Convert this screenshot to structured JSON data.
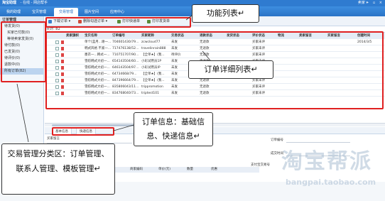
{
  "titlebar": {
    "brand": "淘宝助理",
    "subtitle": "- 在线 - 网店帮手",
    "user": "卖家 ▾",
    "controls": "– ▫ ×"
  },
  "nav": {
    "tabs": [
      "我的助理",
      "宝贝管理",
      "交易管理",
      "图片空间",
      "应用中心"
    ],
    "active_index": 2
  },
  "sidebar": {
    "header": "订单管理",
    "items": [
      {
        "label": "待发货(0)",
        "sub": false
      },
      {
        "label": "买家已付款(0)",
        "sub": true
      },
      {
        "label": "等待卖家发货(0)",
        "sub": true
      },
      {
        "label": "待付款(0)",
        "sub": false
      },
      {
        "label": "已发货(0)",
        "sub": false
      },
      {
        "label": "待评价(0)",
        "sub": false
      },
      {
        "label": "退款中(0)",
        "sub": false
      },
      {
        "label": "所有订单(82)",
        "sub": false,
        "active": true
      }
    ]
  },
  "toolbar": {
    "buttons": [
      {
        "label": "下载订单 ▾",
        "icon": "download-icon",
        "color": "#3a7ecb"
      },
      {
        "label": "删除勾选订单 ▾",
        "icon": "delete-icon",
        "color": "#d04a3a"
      },
      {
        "label": "打印快递单",
        "icon": "print-icon",
        "color": "#5a8a3a"
      },
      {
        "label": "打印发货单",
        "icon": "print-icon",
        "color": "#5a8a3a"
      }
    ]
  },
  "grid": {
    "total_label": "共计: 82",
    "headers": [
      "",
      "卖家旗帜",
      "宝贝名称",
      "订单编号",
      "买家昵称",
      "交易状态",
      "退款状态",
      "发货状态",
      "评价状态",
      "物流",
      "卖家留言",
      "买家留言",
      "创建时间"
    ],
    "rows": [
      {
        "name": "单个[蓝月...谢一...",
        "order": "704601430/79...",
        "buyer": "zcwcloud77",
        "status": "未发",
        "refund": "无退款",
        "rate": "买家未评",
        "time": "2014/3/5"
      },
      {
        "name": "韩式风格 不紧一...",
        "order": "717476138/52...",
        "buyer": "travelinrain888",
        "status": "未发",
        "refund": "无退款",
        "rate": "买家未评",
        "time": ""
      },
      {
        "name": "墨衣一...韩式一...",
        "order": "710751707/90...",
        "buyer": "【全单★】(我...",
        "status": "待评价",
        "refund": "无退款",
        "rate": "买家未评",
        "time": ""
      },
      {
        "name": "雪纺韩式大初一...",
        "order": "654143504/60...",
        "buyer": "小彩试用员1P",
        "status": "未发",
        "refund": "无退款",
        "rate": "买家未评",
        "time": ""
      },
      {
        "name": "雪纺韩式大初一...",
        "order": "646143504/97...",
        "buyer": "小彩试用员IP",
        "status": "未发",
        "refund": "无退款",
        "rate": "买家未评",
        "time": ""
      },
      {
        "name": "雪纺韩式大初一...",
        "order": "64734668/79...",
        "buyer": "【全单★】(我...",
        "status": "未发",
        "refund": "无退款",
        "rate": "买家未评",
        "time": ""
      },
      {
        "name": "雪纺韩式大初一...",
        "order": "847396664/79...",
        "buyer": "【全单★】(我...",
        "status": "未发",
        "refund": "无退款",
        "rate": "买家未评",
        "time": ""
      },
      {
        "name": "雪纺韩式大初一...",
        "order": "835806043/11...",
        "buyer": "trippromotion",
        "status": "未发",
        "refund": "无退款",
        "rate": "买家未评",
        "time": ""
      },
      {
        "name": "雪纺韩式大初一...",
        "order": "834768040/73...",
        "buyer": "triptest101",
        "status": "未发",
        "refund": "无退款",
        "rate": "买家未评",
        "time": ""
      }
    ]
  },
  "detail_tabs": [
    "基本信息",
    "快递信息"
  ],
  "detail": {
    "buyer_msg_label": "买家留言",
    "order_no_label": "订单编号",
    "trade_time_label": "成交时间",
    "payment_label": "支付宝交易号",
    "subgrid_headers": [
      "宝贝标题",
      "商家编码",
      "单价(元)",
      "数量",
      "优惠"
    ]
  },
  "annotations": {
    "func_list": "功能列表↵",
    "order_detail_list": "订单详细列表↵",
    "order_info": "订单信息：基础信息、快递信息↵",
    "trade_mgmt": "交易管理分类区：订单管理、联系人管理、模板管理↵"
  },
  "watermark": {
    "big": "淘宝帮派",
    "url": "bangpai.taobao.com"
  },
  "colors": {
    "nav": "#2a73c6",
    "annotation_border": "#e02020",
    "selected_row": "#cfe0f4"
  }
}
